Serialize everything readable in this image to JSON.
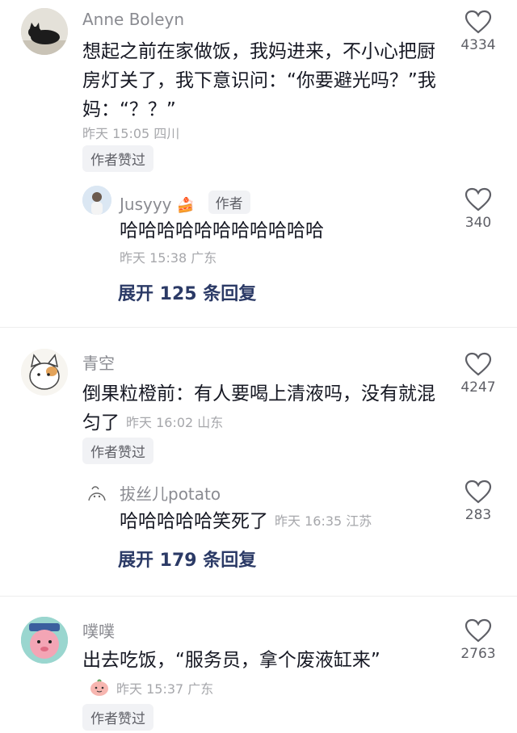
{
  "comments": [
    {
      "username": "Anne Boleyn",
      "text": "想起之前在家做饭，我妈进来，不小心把厨房灯关了，我下意识问：“你要避光吗？”我妈：“？？”",
      "meta": "昨天 15:05 四川",
      "badge": "作者赞过",
      "likes": "4334",
      "reply": {
        "username": "Jusyyy",
        "author_tag": "作者",
        "text": "哈哈哈哈哈哈哈哈哈哈哈",
        "meta": "昨天 15:38 广东",
        "likes": "340"
      },
      "expand_label": "展开 125 条回复"
    },
    {
      "username": "青空",
      "text": "倒果粒橙前：有人要喝上清液吗，没有就混匀了",
      "meta": "昨天 16:02 山东",
      "badge": "作者赞过",
      "likes": "4247",
      "reply": {
        "username": "拔丝儿potato",
        "text": "哈哈哈哈哈笑死了",
        "meta": "昨天 16:35 江苏",
        "likes": "283"
      },
      "expand_label": "展开 179 条回复"
    },
    {
      "username": "噗噗",
      "text": "出去吃饭，“服务员，拿个废液缸来”",
      "meta": "昨天 15:37 广东",
      "badge": "作者赞过",
      "likes": "2763"
    }
  ],
  "icons": {
    "like": "heart-outline-icon",
    "expand": "expand-replies"
  },
  "colors": {
    "expand_link": "#2b3a66",
    "meta": "#a6a7ab",
    "username": "#8a8b91"
  }
}
